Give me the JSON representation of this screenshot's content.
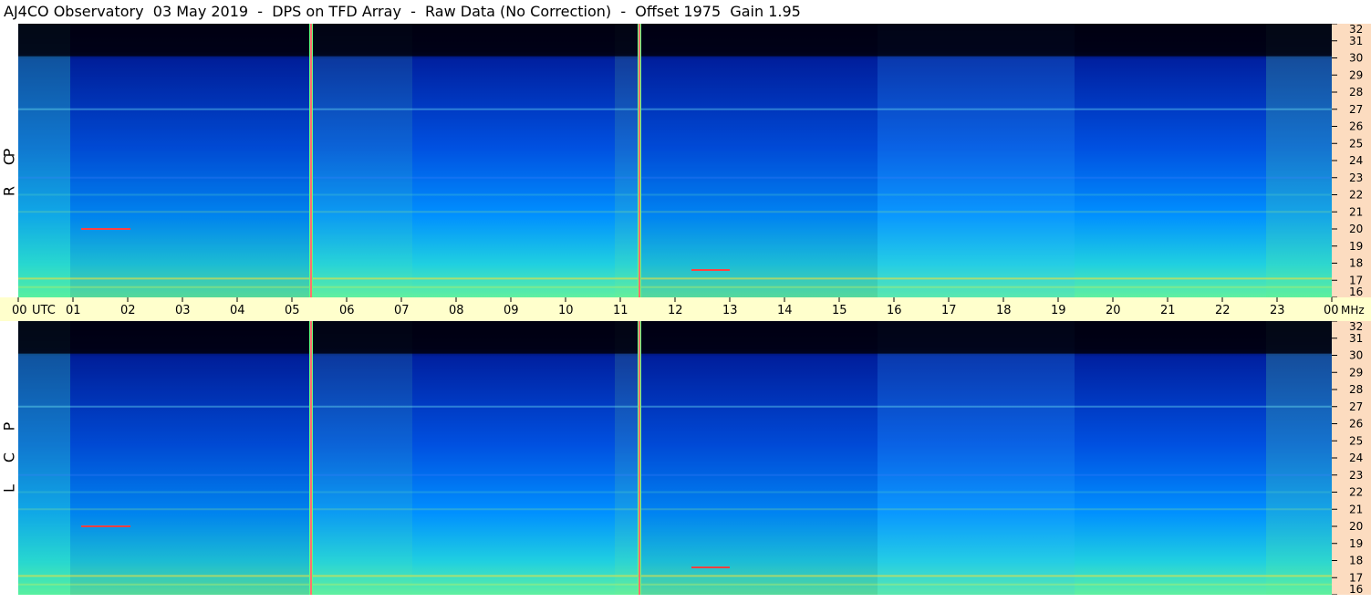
{
  "title": "AJ4CO Observatory  03 May 2019  -  DPS on TFD Array  -  Raw Data (No Correction)  -  Offset 1975  Gain 1.95",
  "panels": [
    {
      "id": "rcp",
      "side_label": [
        "R",
        "C",
        "P"
      ]
    },
    {
      "id": "lcp",
      "side_label": [
        "L",
        "C",
        "P"
      ]
    }
  ],
  "time_axis": {
    "first_label": "00",
    "utc_label": "UTC",
    "labels": [
      "01",
      "02",
      "03",
      "04",
      "05",
      "06",
      "07",
      "08",
      "09",
      "10",
      "11",
      "12",
      "13",
      "14",
      "15",
      "16",
      "17",
      "18",
      "19",
      "20",
      "21",
      "22",
      "23"
    ],
    "last_label": "00",
    "unit_label": "MHz"
  },
  "chart_data": {
    "type": "heatmap",
    "title": "AJ4CO Observatory  03 May 2019  -  DPS on TFD Array  -  Raw Data (No Correction)  -  Offset 1975  Gain 1.95",
    "xlabel": "UTC",
    "ylabel": "MHz",
    "xlim": [
      0,
      24
    ],
    "ylim": [
      16,
      32
    ],
    "x_ticks": [
      "00",
      "01",
      "02",
      "03",
      "04",
      "05",
      "06",
      "07",
      "08",
      "09",
      "10",
      "11",
      "12",
      "13",
      "14",
      "15",
      "16",
      "17",
      "18",
      "19",
      "20",
      "21",
      "22",
      "23",
      "00"
    ],
    "y_ticks": [
      "16",
      "17",
      "18",
      "19",
      "20",
      "21",
      "22",
      "23",
      "24",
      "25",
      "26",
      "27",
      "28",
      "29",
      "30",
      "31",
      "32"
    ],
    "series": [
      {
        "name": "RCP",
        "label_letters": [
          "R",
          "C",
          "P"
        ]
      },
      {
        "name": "LCP",
        "label_letters": [
          "L",
          "C",
          "P"
        ]
      }
    ],
    "colorscale": [
      "#000010",
      "#000a40",
      "#0020a0",
      "#0050e0",
      "#0090ff",
      "#20d0e0",
      "#60f0a0",
      "#c0f060",
      "#f0e040",
      "#ff4040"
    ],
    "vertical_markers_utc": [
      5.35,
      11.35
    ],
    "marker_color": "#ff7070"
  }
}
